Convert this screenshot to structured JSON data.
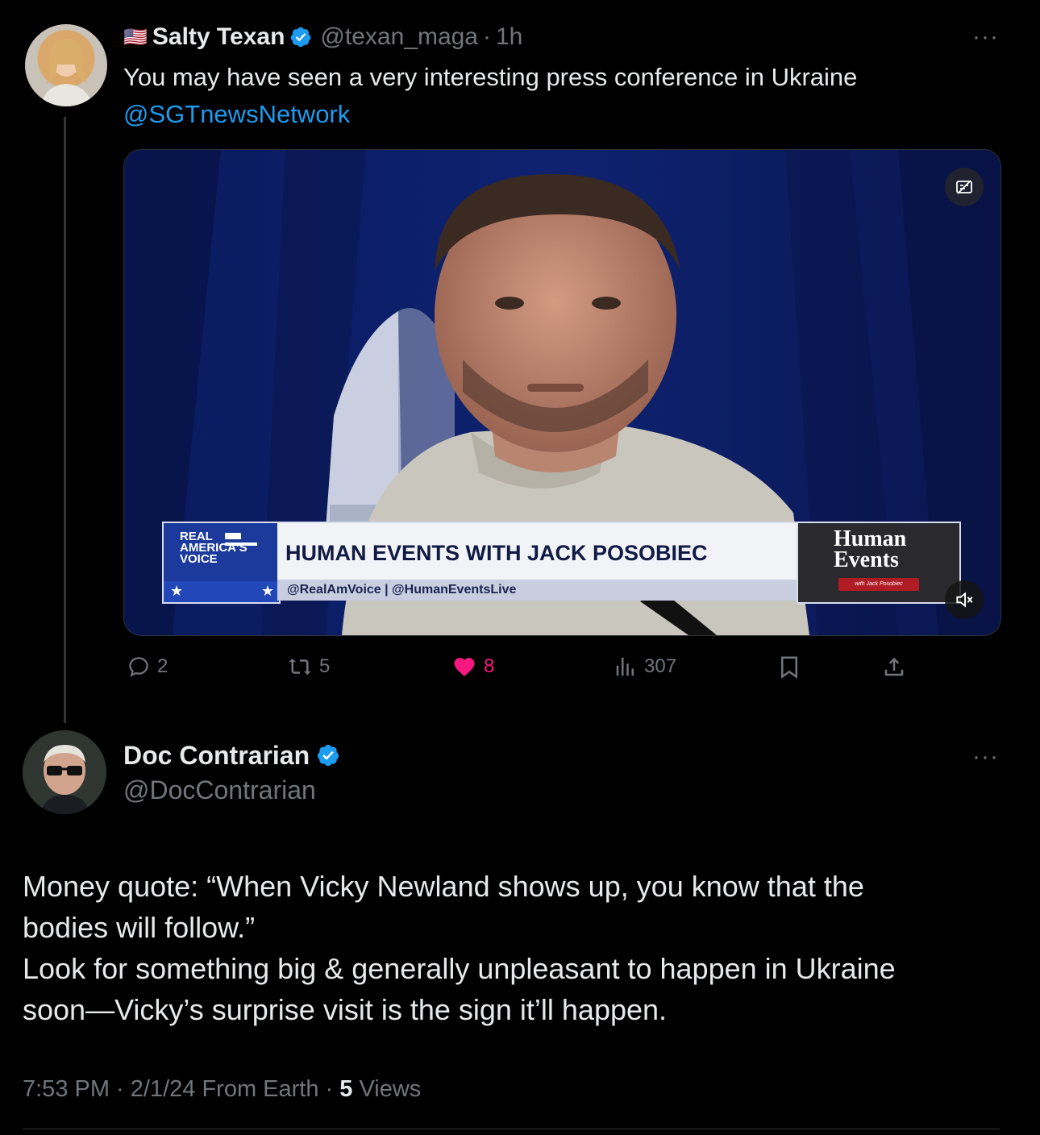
{
  "tweet1": {
    "flag": "🇺🇸",
    "display_name": "Salty Texan",
    "handle": "@texan_maga",
    "sep": "·",
    "time": "1h",
    "text": "You may have seen a very interesting press conference in Ukraine",
    "mention": "@SGTnewsNetwork",
    "more": "···",
    "video": {
      "network_logo": [
        "REAL",
        "AMERICA'S",
        "VOICE"
      ],
      "headline": "HUMAN EVENTS WITH JACK POSOBIEC",
      "subline": "@RealAmVoice | @HumanEventsLive",
      "brand_line1": "Human",
      "brand_line2": "Events",
      "brand_tag": "with Jack Posobiec"
    },
    "actions": {
      "replies": "2",
      "reposts": "5",
      "likes": "8",
      "views": "307"
    },
    "colors": {
      "like": "#f91880",
      "link": "#1d9bf0",
      "verified": "#1d9bf0"
    }
  },
  "tweet2": {
    "display_name": "Doc Contrarian",
    "handle": "@DocContrarian",
    "more": "···",
    "text_line1": "Money quote: “When Vicky Newland shows up, you know that the",
    "text_line2": "bodies will follow.”",
    "text_line3": "Look for something big & generally unpleasant to happen in Ukraine",
    "text_line4": "soon—Vicky’s surprise visit is the sign it’ll happen.",
    "meta_time": "7:53 PM · 2/1/24 From Earth · ",
    "views_count": "5",
    "views_label": " Views"
  }
}
